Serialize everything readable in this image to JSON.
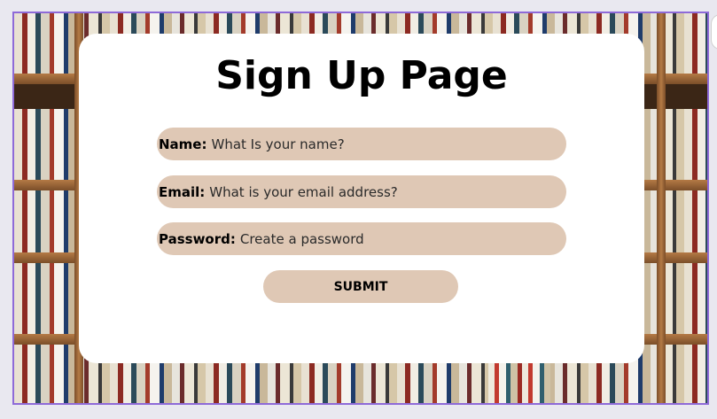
{
  "page": {
    "title": "Sign Up Page"
  },
  "form": {
    "fields": [
      {
        "label": "Name:",
        "placeholder": "What Is your name?"
      },
      {
        "label": "Email:",
        "placeholder": "What is your email address?"
      },
      {
        "label": "Password:",
        "placeholder": "Create a password"
      }
    ],
    "submit_label": "SUBMIT"
  },
  "colors": {
    "field_background": "#dfc8b5",
    "card_background": "#ffffff",
    "frame_border": "#8e6ad8"
  }
}
